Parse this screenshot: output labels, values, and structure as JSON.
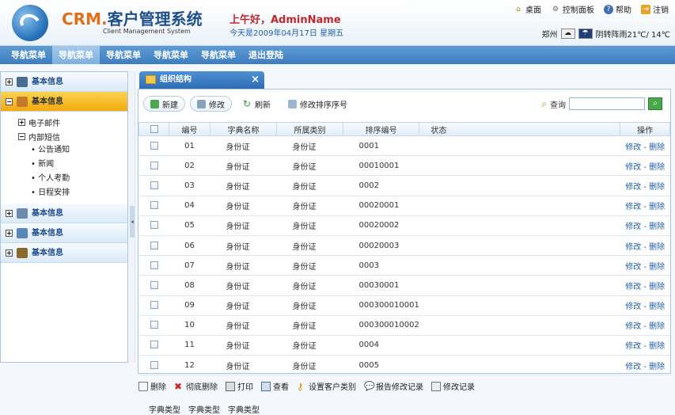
{
  "header": {
    "logo_main": "CRM.",
    "logo_cn": "客户管理系统",
    "logo_sub": "Client Management System",
    "greeting": "上午好，AdminName",
    "date": "今天是2009年04月17日 星期五",
    "links": [
      "桌面",
      "控制面板",
      "帮助",
      "注销"
    ],
    "city": "郑州",
    "weather": "阴转阵雨21℃/ 14℃"
  },
  "nav": {
    "items": [
      "导航菜单",
      "导航菜单",
      "导航菜单",
      "导航菜单",
      "导航菜单",
      "退出登陆"
    ],
    "active_index": 1
  },
  "sidebar": {
    "sections": [
      {
        "label": "基本信息"
      },
      {
        "label": "基本信息"
      },
      {
        "label": "基本信息"
      },
      {
        "label": "基本信息"
      },
      {
        "label": "基本信息"
      }
    ],
    "tree": {
      "email": "电子邮件",
      "sms": "内部短信",
      "leaves": [
        "公告通知",
        "新闻",
        "个人考勤",
        "日程安排"
      ]
    }
  },
  "panel": {
    "tab_title": "组织结构",
    "toolbar": {
      "new": "新建",
      "edit": "修改",
      "refresh": "刷新",
      "reorder": "修改排序序号"
    },
    "search_label": "查询",
    "search_value": "",
    "columns": [
      "编号",
      "字典名称",
      "所属类别",
      "排序编号",
      "状态",
      "操作"
    ],
    "rows": [
      {
        "id": "01",
        "name": "身份证",
        "cat": "身份证",
        "order": "0001"
      },
      {
        "id": "02",
        "name": "身份证",
        "cat": "身份证",
        "order": "00010001"
      },
      {
        "id": "03",
        "name": "身份证",
        "cat": "身份证",
        "order": "0002"
      },
      {
        "id": "04",
        "name": "身份证",
        "cat": "身份证",
        "order": "00020001"
      },
      {
        "id": "05",
        "name": "身份证",
        "cat": "身份证",
        "order": "00020002"
      },
      {
        "id": "06",
        "name": "身份证",
        "cat": "身份证",
        "order": "00020003"
      },
      {
        "id": "07",
        "name": "身份证",
        "cat": "身份证",
        "order": "0003"
      },
      {
        "id": "08",
        "name": "身份证",
        "cat": "身份证",
        "order": "00030001"
      },
      {
        "id": "09",
        "name": "身份证",
        "cat": "身份证",
        "order": "000300010001"
      },
      {
        "id": "10",
        "name": "身份证",
        "cat": "身份证",
        "order": "000300010002"
      },
      {
        "id": "11",
        "name": "身份证",
        "cat": "身份证",
        "order": "0004"
      },
      {
        "id": "12",
        "name": "身份证",
        "cat": "身份证",
        "order": "0005"
      }
    ],
    "row_ops": "修改 - 删除"
  },
  "bottom": {
    "actions": [
      "删除",
      "彻底删除",
      "打印",
      "查看",
      "设置客户类别",
      "报告修改记录",
      "修改记录"
    ],
    "links": [
      "字典类型",
      "字典类型",
      "字典类型"
    ]
  },
  "colors": {
    "accent": "#3d7dc0",
    "active": "#f2a90f",
    "link": "#1f5fa8",
    "greeting": "#c0282d"
  }
}
